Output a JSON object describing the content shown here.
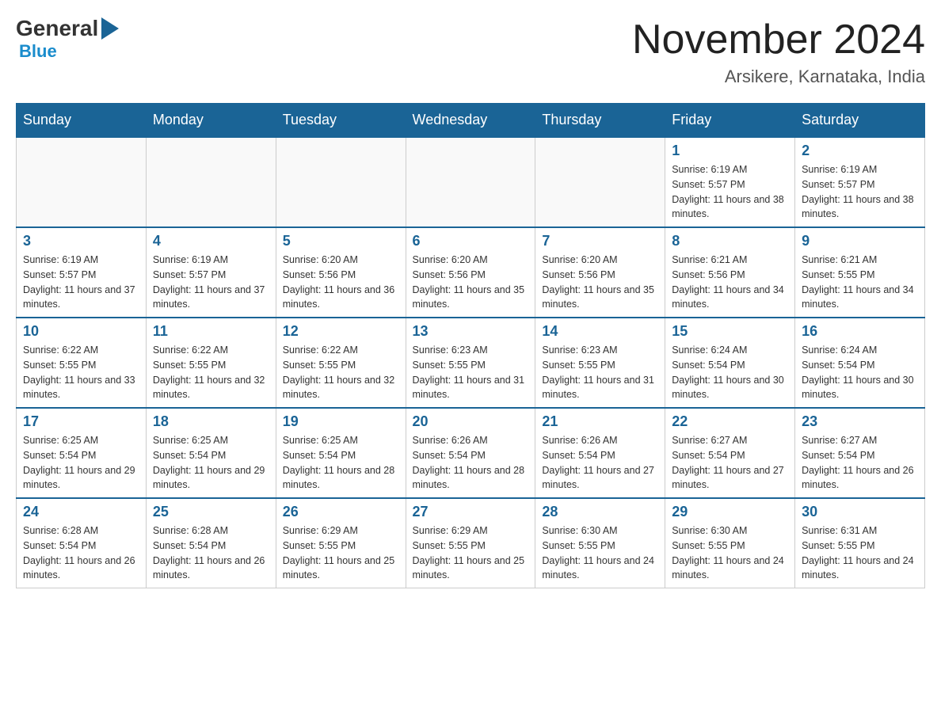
{
  "header": {
    "logo_general": "General",
    "logo_blue": "Blue",
    "month_title": "November 2024",
    "location": "Arsikere, Karnataka, India"
  },
  "days_of_week": [
    "Sunday",
    "Monday",
    "Tuesday",
    "Wednesday",
    "Thursday",
    "Friday",
    "Saturday"
  ],
  "weeks": [
    [
      {
        "day": "",
        "info": ""
      },
      {
        "day": "",
        "info": ""
      },
      {
        "day": "",
        "info": ""
      },
      {
        "day": "",
        "info": ""
      },
      {
        "day": "",
        "info": ""
      },
      {
        "day": "1",
        "info": "Sunrise: 6:19 AM\nSunset: 5:57 PM\nDaylight: 11 hours and 38 minutes."
      },
      {
        "day": "2",
        "info": "Sunrise: 6:19 AM\nSunset: 5:57 PM\nDaylight: 11 hours and 38 minutes."
      }
    ],
    [
      {
        "day": "3",
        "info": "Sunrise: 6:19 AM\nSunset: 5:57 PM\nDaylight: 11 hours and 37 minutes."
      },
      {
        "day": "4",
        "info": "Sunrise: 6:19 AM\nSunset: 5:57 PM\nDaylight: 11 hours and 37 minutes."
      },
      {
        "day": "5",
        "info": "Sunrise: 6:20 AM\nSunset: 5:56 PM\nDaylight: 11 hours and 36 minutes."
      },
      {
        "day": "6",
        "info": "Sunrise: 6:20 AM\nSunset: 5:56 PM\nDaylight: 11 hours and 35 minutes."
      },
      {
        "day": "7",
        "info": "Sunrise: 6:20 AM\nSunset: 5:56 PM\nDaylight: 11 hours and 35 minutes."
      },
      {
        "day": "8",
        "info": "Sunrise: 6:21 AM\nSunset: 5:56 PM\nDaylight: 11 hours and 34 minutes."
      },
      {
        "day": "9",
        "info": "Sunrise: 6:21 AM\nSunset: 5:55 PM\nDaylight: 11 hours and 34 minutes."
      }
    ],
    [
      {
        "day": "10",
        "info": "Sunrise: 6:22 AM\nSunset: 5:55 PM\nDaylight: 11 hours and 33 minutes."
      },
      {
        "day": "11",
        "info": "Sunrise: 6:22 AM\nSunset: 5:55 PM\nDaylight: 11 hours and 32 minutes."
      },
      {
        "day": "12",
        "info": "Sunrise: 6:22 AM\nSunset: 5:55 PM\nDaylight: 11 hours and 32 minutes."
      },
      {
        "day": "13",
        "info": "Sunrise: 6:23 AM\nSunset: 5:55 PM\nDaylight: 11 hours and 31 minutes."
      },
      {
        "day": "14",
        "info": "Sunrise: 6:23 AM\nSunset: 5:55 PM\nDaylight: 11 hours and 31 minutes."
      },
      {
        "day": "15",
        "info": "Sunrise: 6:24 AM\nSunset: 5:54 PM\nDaylight: 11 hours and 30 minutes."
      },
      {
        "day": "16",
        "info": "Sunrise: 6:24 AM\nSunset: 5:54 PM\nDaylight: 11 hours and 30 minutes."
      }
    ],
    [
      {
        "day": "17",
        "info": "Sunrise: 6:25 AM\nSunset: 5:54 PM\nDaylight: 11 hours and 29 minutes."
      },
      {
        "day": "18",
        "info": "Sunrise: 6:25 AM\nSunset: 5:54 PM\nDaylight: 11 hours and 29 minutes."
      },
      {
        "day": "19",
        "info": "Sunrise: 6:25 AM\nSunset: 5:54 PM\nDaylight: 11 hours and 28 minutes."
      },
      {
        "day": "20",
        "info": "Sunrise: 6:26 AM\nSunset: 5:54 PM\nDaylight: 11 hours and 28 minutes."
      },
      {
        "day": "21",
        "info": "Sunrise: 6:26 AM\nSunset: 5:54 PM\nDaylight: 11 hours and 27 minutes."
      },
      {
        "day": "22",
        "info": "Sunrise: 6:27 AM\nSunset: 5:54 PM\nDaylight: 11 hours and 27 minutes."
      },
      {
        "day": "23",
        "info": "Sunrise: 6:27 AM\nSunset: 5:54 PM\nDaylight: 11 hours and 26 minutes."
      }
    ],
    [
      {
        "day": "24",
        "info": "Sunrise: 6:28 AM\nSunset: 5:54 PM\nDaylight: 11 hours and 26 minutes."
      },
      {
        "day": "25",
        "info": "Sunrise: 6:28 AM\nSunset: 5:54 PM\nDaylight: 11 hours and 26 minutes."
      },
      {
        "day": "26",
        "info": "Sunrise: 6:29 AM\nSunset: 5:55 PM\nDaylight: 11 hours and 25 minutes."
      },
      {
        "day": "27",
        "info": "Sunrise: 6:29 AM\nSunset: 5:55 PM\nDaylight: 11 hours and 25 minutes."
      },
      {
        "day": "28",
        "info": "Sunrise: 6:30 AM\nSunset: 5:55 PM\nDaylight: 11 hours and 24 minutes."
      },
      {
        "day": "29",
        "info": "Sunrise: 6:30 AM\nSunset: 5:55 PM\nDaylight: 11 hours and 24 minutes."
      },
      {
        "day": "30",
        "info": "Sunrise: 6:31 AM\nSunset: 5:55 PM\nDaylight: 11 hours and 24 minutes."
      }
    ]
  ]
}
